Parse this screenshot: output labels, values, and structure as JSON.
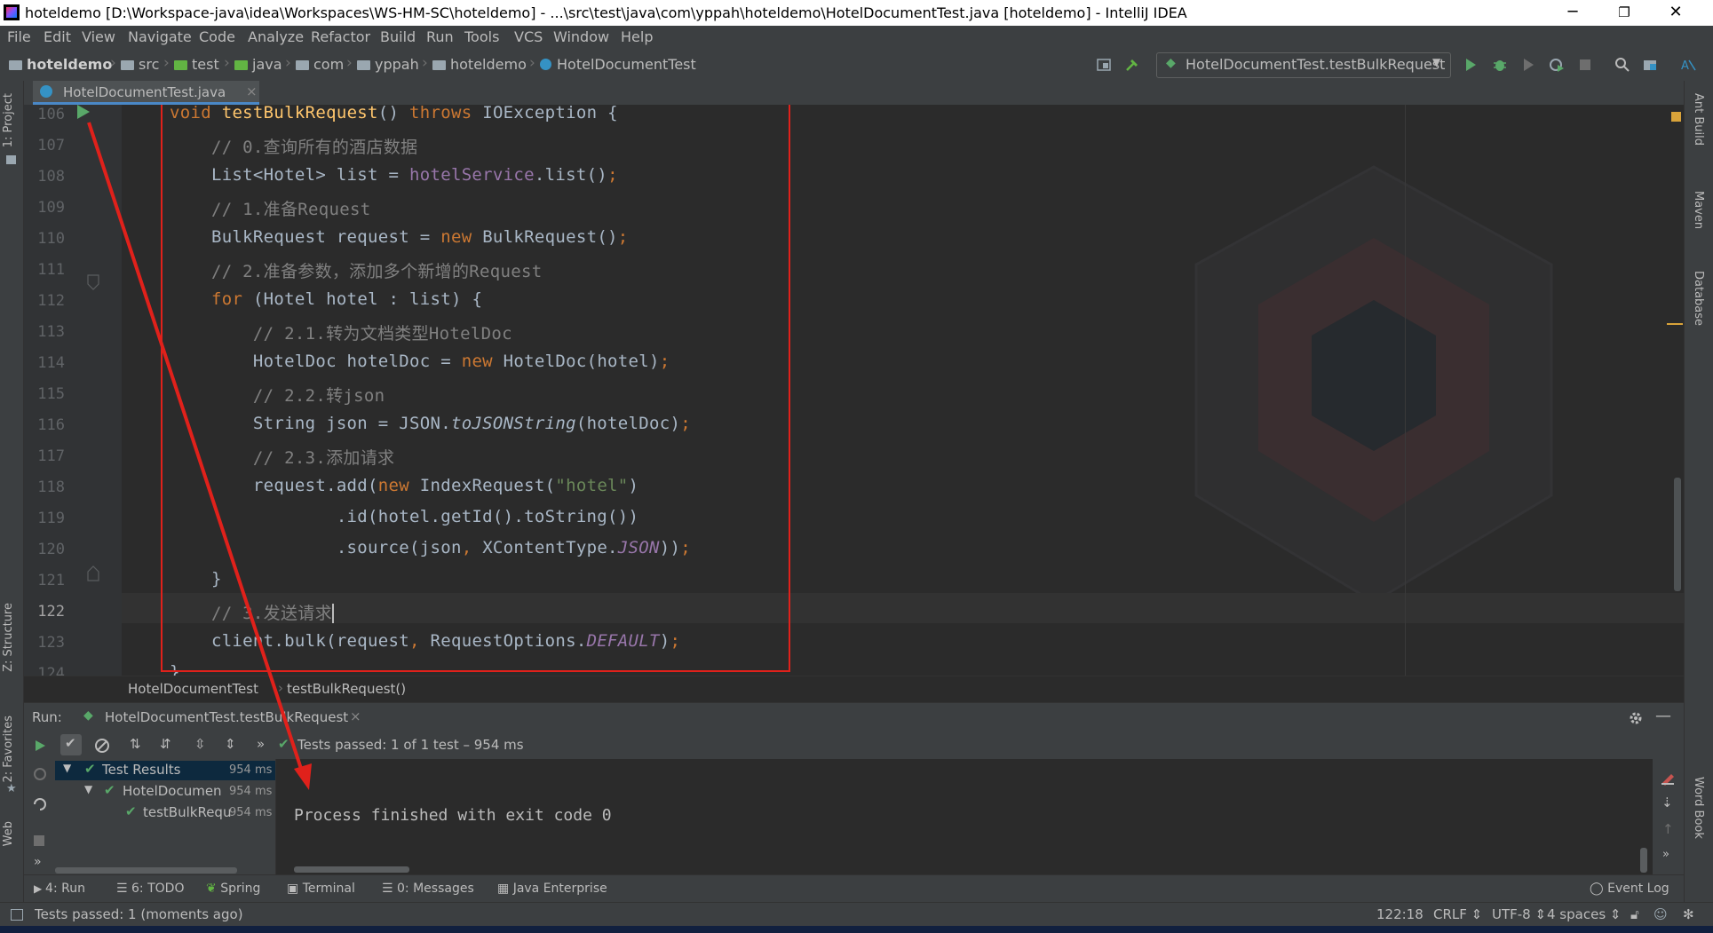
{
  "window": {
    "title": "hoteldemo [D:\\Workspace-java\\idea\\Workspaces\\WS-HM-SC\\hoteldemo] - ...\\src\\test\\java\\com\\yppah\\hoteldemo\\HotelDocumentTest.java [hoteldemo] - IntelliJ IDEA",
    "minimize": "─",
    "maximize": "❐",
    "close": "✕"
  },
  "menu": [
    "File",
    "Edit",
    "View",
    "Navigate",
    "Code",
    "Analyze",
    "Refactor",
    "Build",
    "Run",
    "Tools",
    "VCS",
    "Window",
    "Help"
  ],
  "navbar": {
    "crumbs": [
      "hoteldemo",
      "src",
      "test",
      "java",
      "com",
      "yppah",
      "hoteldemo",
      "HotelDocumentTest"
    ],
    "run_config": "HotelDocumentTest.testBulkRequest"
  },
  "editor": {
    "tab_label": "HotelDocumentTest.java",
    "line_numbers": [
      "106",
      "107",
      "108",
      "109",
      "110",
      "111",
      "112",
      "113",
      "114",
      "115",
      "116",
      "117",
      "118",
      "119",
      "120",
      "121",
      "122",
      "123",
      "124"
    ],
    "breadcrumb_class": "HotelDocumentTest",
    "breadcrumb_method": "testBulkRequest()"
  },
  "left_strip": {
    "project": "1: Project",
    "structure": "Z: Structure",
    "favorites": "2: Favorites",
    "web": "Web"
  },
  "right_strip": {
    "ant": "Ant Build",
    "maven": "Maven",
    "database": "Database",
    "wordbook": "Word Book"
  },
  "run_panel": {
    "label": "Run:",
    "tab": "HotelDocumentTest.testBulkRequest",
    "status": "Tests passed: ",
    "status_count": "1 of 1 test",
    "status_time": " – 954 ms",
    "more": "»",
    "tree": [
      {
        "label": "Test Results",
        "time": "954 ms"
      },
      {
        "label": "HotelDocumen",
        "time": "954 ms"
      },
      {
        "label": "testBulkRequ",
        "time": "954 ms"
      }
    ],
    "console_output": "Process finished with exit code 0"
  },
  "tool_tabs": {
    "run": "4: Run",
    "todo": "6: TODO",
    "spring": "Spring",
    "terminal": "Terminal",
    "messages": "0: Messages",
    "java_enterprise": "Java Enterprise",
    "event_log": "Event Log"
  },
  "statusbar": {
    "message": "Tests passed: 1 (moments ago)",
    "position": "122:18",
    "line_sep": "CRLF ⇕",
    "encoding": "UTF-8 ⇕",
    "indent": "4 spaces ⇕"
  },
  "colors": {
    "annotation_red": "#e0211b",
    "keyword": "#cc7832",
    "comment": "#808080",
    "field": "#9876aa",
    "string": "#6a8759",
    "pass_green": "#59a869"
  }
}
